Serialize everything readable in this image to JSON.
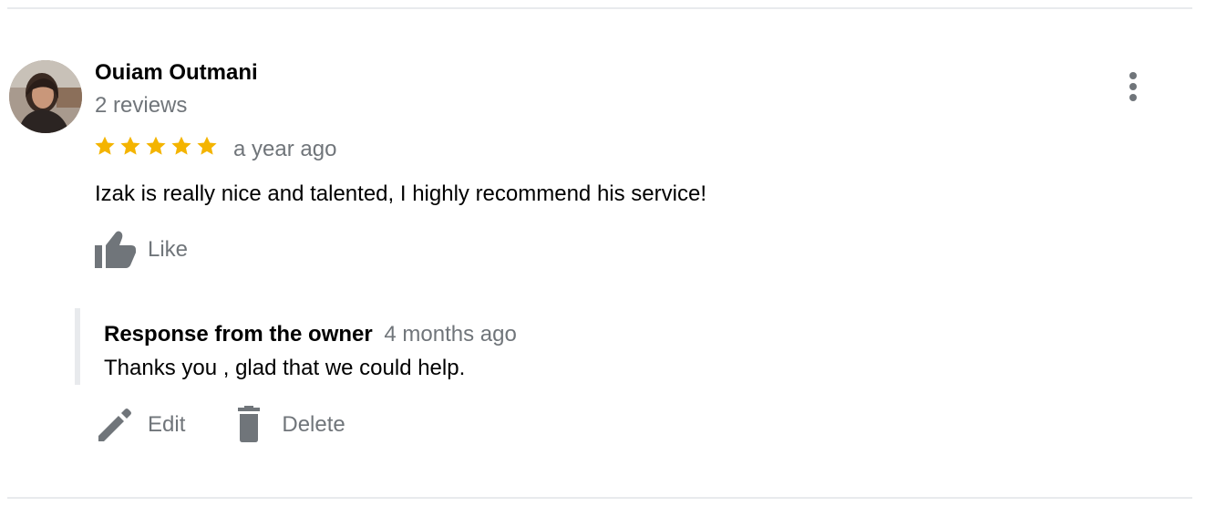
{
  "review": {
    "reviewer_name": "Ouiam Outmani",
    "review_count": "2 reviews",
    "rating": 5,
    "max_rating": 5,
    "time_ago": "a year ago",
    "text": "Izak is really nice and talented, I highly recommend his service!",
    "like_label": "Like"
  },
  "response": {
    "title": "Response from the owner",
    "time_ago": "4 months ago",
    "text": "Thanks you , glad that we could help."
  },
  "actions": {
    "edit_label": "Edit",
    "delete_label": "Delete"
  },
  "icons": {
    "more": "more-vert-icon",
    "star": "star-icon",
    "like": "thumb-up-icon",
    "edit": "pencil-icon",
    "delete": "trash-icon"
  },
  "colors": {
    "star": "#f4b400",
    "icon_gray": "#70757a",
    "divider": "#e8eaed"
  }
}
